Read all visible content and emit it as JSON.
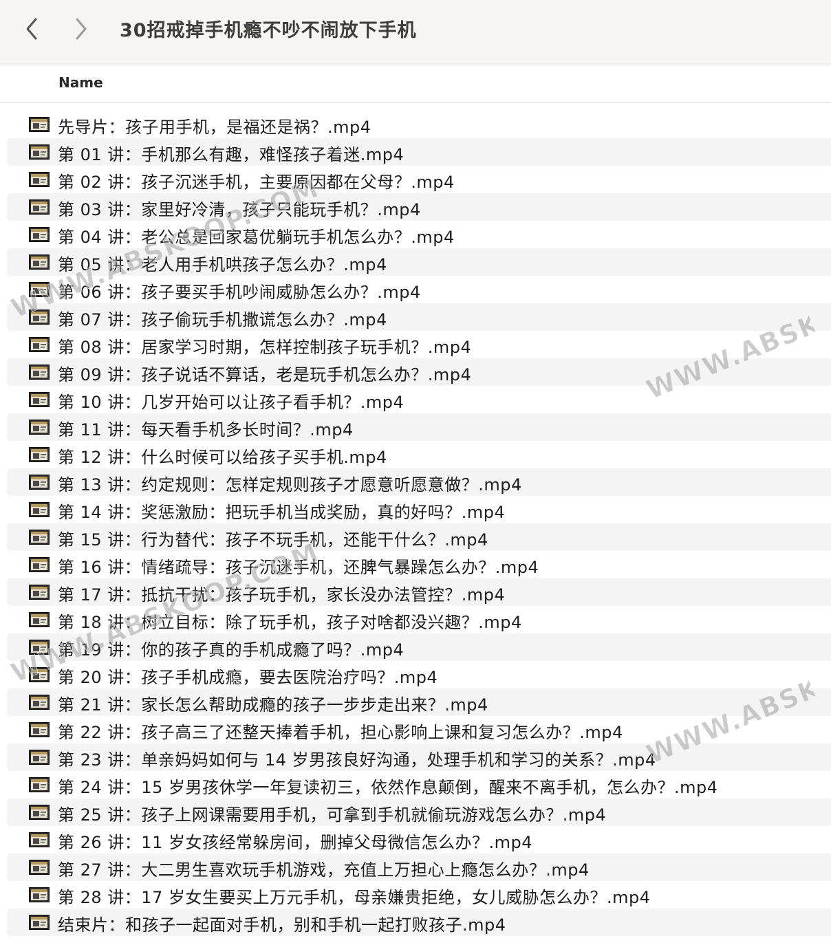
{
  "window": {
    "title": "30招戒掉手机瘾不吵不闹放下手机"
  },
  "columns": {
    "name": "Name"
  },
  "watermark_text": "WWW.ABSKOOP.COM",
  "files": [
    {
      "name": "先导片：孩子用手机，是福还是祸？.mp4",
      "icon": "video-thumbnail-icon"
    },
    {
      "name": "第 01 讲：手机那么有趣，难怪孩子着迷.mp4",
      "icon": "video-thumbnail-icon"
    },
    {
      "name": "第 02 讲：孩子沉迷手机，主要原因都在父母？.mp4",
      "icon": "video-thumbnail-icon"
    },
    {
      "name": "第 03 讲：家里好冷清，孩子只能玩手机？.mp4",
      "icon": "video-thumbnail-icon"
    },
    {
      "name": "第 04 讲：老公总是回家葛优躺玩手机怎么办？.mp4",
      "icon": "video-thumbnail-icon"
    },
    {
      "name": "第 05 讲：老人用手机哄孩子怎么办？.mp4",
      "icon": "video-thumbnail-icon"
    },
    {
      "name": "第 06 讲：孩子要买手机吵闹威胁怎么办？.mp4",
      "icon": "video-thumbnail-icon"
    },
    {
      "name": "第 07 讲：孩子偷玩手机撒谎怎么办？.mp4",
      "icon": "video-thumbnail-icon"
    },
    {
      "name": "第 08 讲：居家学习时期，怎样控制孩子玩手机？.mp4",
      "icon": "video-thumbnail-icon"
    },
    {
      "name": "第 09 讲：孩子说话不算话，老是玩手机怎么办？.mp4",
      "icon": "video-thumbnail-icon"
    },
    {
      "name": "第 10 讲：几岁开始可以让孩子看手机？.mp4",
      "icon": "video-thumbnail-icon"
    },
    {
      "name": "第 11 讲：每天看手机多长时间？.mp4",
      "icon": "video-thumbnail-icon"
    },
    {
      "name": "第 12 讲：什么时候可以给孩子买手机.mp4",
      "icon": "video-thumbnail-icon"
    },
    {
      "name": "第 13 讲：约定规则：怎样定规则孩子才愿意听愿意做？.mp4",
      "icon": "video-thumbnail-icon"
    },
    {
      "name": "第 14 讲：奖惩激励：把玩手机当成奖励，真的好吗？.mp4",
      "icon": "video-thumbnail-icon"
    },
    {
      "name": "第 15 讲：行为替代：孩子不玩手机，还能干什么？.mp4",
      "icon": "video-thumbnail-icon"
    },
    {
      "name": "第 16 讲：情绪疏导：孩子沉迷手机，还脾气暴躁怎么办？.mp4",
      "icon": "video-thumbnail-icon"
    },
    {
      "name": "第 17 讲：抵抗干扰：孩子玩手机，家长没办法管控？.mp4",
      "icon": "video-thumbnail-icon"
    },
    {
      "name": "第 18 讲：树立目标：除了玩手机，孩子对啥都没兴趣？.mp4",
      "icon": "video-thumbnail-icon"
    },
    {
      "name": "第 19 讲：你的孩子真的手机成瘾了吗？.mp4",
      "icon": "video-thumbnail-icon"
    },
    {
      "name": "第 20 讲：孩子手机成瘾，要去医院治疗吗？.mp4",
      "icon": "video-thumbnail-icon"
    },
    {
      "name": "第 21 讲：家长怎么帮助成瘾的孩子一步步走出来？.mp4",
      "icon": "video-thumbnail-icon"
    },
    {
      "name": "第 22 讲：孩子高三了还整天捧着手机，担心影响上课和复习怎么办？.mp4",
      "icon": "video-thumbnail-icon"
    },
    {
      "name": "第 23 讲：单亲妈妈如何与 14 岁男孩良好沟通，处理手机和学习的关系？.mp4",
      "icon": "video-thumbnail-icon"
    },
    {
      "name": "第 24 讲：15 岁男孩休学一年复读初三，依然作息颠倒，醒来不离手机，怎么办？.mp4",
      "icon": "video-thumbnail-icon"
    },
    {
      "name": "第 25 讲：孩子上网课需要用手机，可拿到手机就偷玩游戏怎么办？.mp4",
      "icon": "video-thumbnail-icon"
    },
    {
      "name": "第 26 讲：11 岁女孩经常躲房间，删掉父母微信怎么办？.mp4",
      "icon": "video-thumbnail-icon"
    },
    {
      "name": "第 27 讲：大二男生喜欢玩手机游戏，充值上万担心上瘾怎么办？.mp4",
      "icon": "video-thumbnail-icon"
    },
    {
      "name": "第 28 讲：17 岁女生要买上万元手机，母亲嫌贵拒绝，女儿威胁怎么办？.mp4",
      "icon": "video-thumbnail-icon"
    },
    {
      "name": "结束片：和孩子一起面对手机，别和手机一起打败孩子.mp4",
      "icon": "video-thumbnail-icon"
    }
  ],
  "colors": {
    "toolbar_bg": "#f7f4f1",
    "alt_row_bg": "#f4f4f4",
    "text": "#1e1e1e"
  }
}
